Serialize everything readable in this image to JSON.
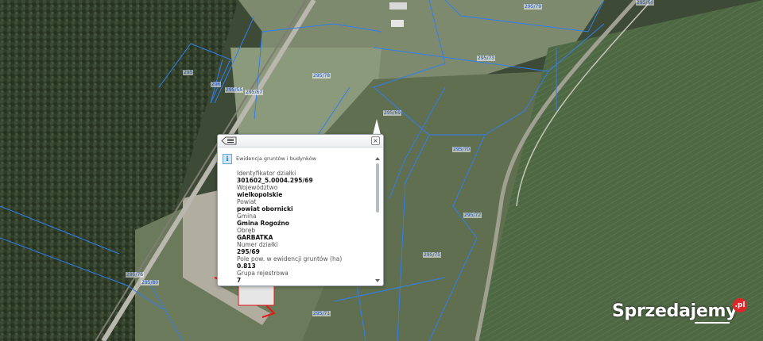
{
  "map": {
    "parcel_labels": [
      "295",
      "296",
      "295/55",
      "295/67",
      "295/78",
      "295/73",
      "295/69",
      "295/70",
      "295/79",
      "295/72",
      "295/75",
      "295/71",
      "295/76",
      "295/80",
      "295/60",
      "295/74",
      "295/80"
    ],
    "colors": {
      "forest": "#2f3d2a",
      "field_light": "#8c9a7c",
      "field_green": "#55704a",
      "parcel_border": "#2f7ff0",
      "road": "#b9b7ae",
      "building_outline": "#e21818"
    }
  },
  "popup": {
    "back_icon": "list-back-icon",
    "close_icon": "close-icon",
    "info_icon": "info-icon",
    "title": "Ewidencja gruntów i budynków",
    "fields": [
      {
        "label": "Identyfikator działki",
        "value": "301602_5.0004.295/69"
      },
      {
        "label": "Województwo",
        "value": "wielkopolskie"
      },
      {
        "label": "Powiat",
        "value": "powiat obornicki"
      },
      {
        "label": "Gmina",
        "value": "Gmina Rogoźno"
      },
      {
        "label": "Obręb",
        "value": "GARBATKA"
      },
      {
        "label": "Numer działki",
        "value": "295/69"
      },
      {
        "label": "Pole pow. w ewidencji gruntów (ha)",
        "value": "0.813"
      },
      {
        "label": "Grupa rejestrowa",
        "value": "7"
      }
    ]
  },
  "watermark": {
    "text": "Sprzedajemy",
    "badge": ".pl",
    "color": "#e0262a"
  }
}
